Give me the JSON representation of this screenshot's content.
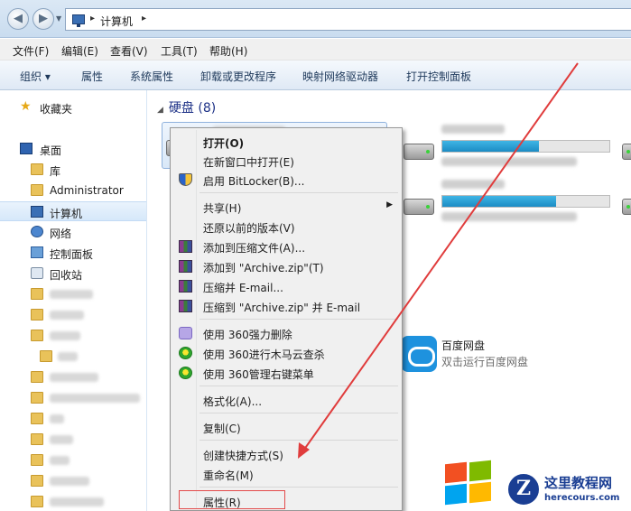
{
  "address": {
    "root": "计算机"
  },
  "menu": {
    "file": "文件(F)",
    "edit": "编辑(E)",
    "view": "查看(V)",
    "tools": "工具(T)",
    "help": "帮助(H)"
  },
  "toolbar": {
    "organize": "组织 ▾",
    "properties": "属性",
    "system_properties": "系统属性",
    "uninstall": "卸载或更改程序",
    "map_drive": "映射网络驱动器",
    "control_panel": "打开控制面板"
  },
  "sidebar": {
    "favorites": "收藏夹",
    "desktop": "桌面",
    "libraries": "库",
    "admin": "Administrator",
    "computer": "计算机",
    "network": "网络",
    "control_panel": "控制面板",
    "recycle_bin": "回收站"
  },
  "content": {
    "drives_header": "硬盘 (8)",
    "drive_usage_fraction": [
      0.58,
      0.68
    ],
    "baidu_name": "百度网盘",
    "baidu_desc": "双击运行百度网盘"
  },
  "context_menu": {
    "open": "打开(O)",
    "open_new_window": "在新窗口中打开(E)",
    "bitlocker": "启用 BitLocker(B)...",
    "share": "共享(H)",
    "restore": "还原以前的版本(V)",
    "add_archive": "添加到压缩文件(A)...",
    "add_zip": "添加到 \"Archive.zip\"(T)",
    "compress_email": "压缩并 E-mail...",
    "compress_zip_email": "压缩到 \"Archive.zip\" 并 E-mail",
    "del360": "使用 360强力删除",
    "scan360": "使用 360进行木马云查杀",
    "manage360": "使用 360管理右键菜单",
    "format": "格式化(A)...",
    "copy": "复制(C)",
    "shortcut": "创建快捷方式(S)",
    "rename": "重命名(M)",
    "properties": "属性(R)"
  },
  "watermark": {
    "title": "这里教程网",
    "url": "herecours.com"
  },
  "colors": {
    "arrow": "#e03c3c",
    "highlight_box": "#e34a4a",
    "selection": "#d6e8fa"
  },
  "icons": [
    "back-icon",
    "forward-icon",
    "computer-icon",
    "star-icon",
    "desktop-icon",
    "library-icon",
    "folder-icon",
    "network-icon",
    "control-panel-icon",
    "recycle-bin-icon",
    "hard-drive-icon",
    "shield-icon",
    "winrar-icon",
    "360-icon",
    "baidu-pan-icon",
    "windows-logo-icon"
  ]
}
